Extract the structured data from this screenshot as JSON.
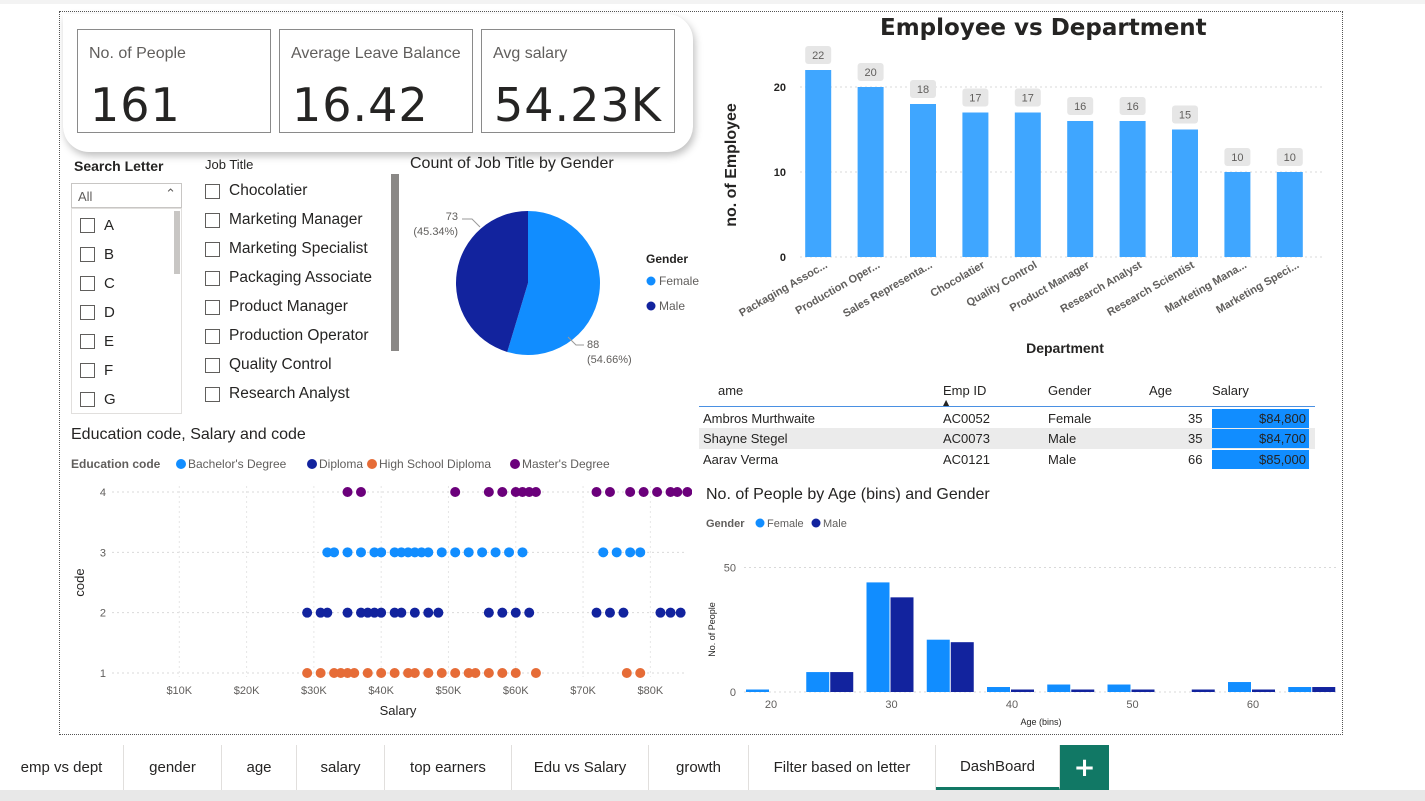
{
  "kpis": [
    {
      "label": "No. of People",
      "value": "161"
    },
    {
      "label": "Average Leave Balance",
      "value": "16.42"
    },
    {
      "label": "Avg salary",
      "value": "54.23K"
    }
  ],
  "search_letter": {
    "title": "Search Letter",
    "selected": "All",
    "options": [
      "A",
      "B",
      "C",
      "D",
      "E",
      "F",
      "G"
    ]
  },
  "job_title": {
    "title": "Job Title",
    "options": [
      "Chocolatier",
      "Marketing Manager",
      "Marketing Specialist",
      "Packaging Associate",
      "Product Manager",
      "Production Operator",
      "Quality Control",
      "Research Analyst"
    ]
  },
  "pie": {
    "title": "Count of Job Title by Gender",
    "legend_title": "Gender",
    "colors": {
      "Female": "#118dff",
      "Male": "#12239e"
    },
    "chart_data": {
      "type": "pie",
      "title": "Count of Job Title by Gender",
      "slices": [
        {
          "name": "Female",
          "value": 88,
          "label": "88",
          "pct": "(54.66%)"
        },
        {
          "name": "Male",
          "value": 73,
          "label": "73",
          "pct": "(45.34%)"
        }
      ]
    }
  },
  "bar": {
    "title": "Employee vs Department",
    "color": "#3fa6ff",
    "chart_data": {
      "type": "bar",
      "title": "Employee vs Department",
      "xlabel": "Department",
      "ylabel": "no. of Employee",
      "categories": [
        "Packaging Assoc...",
        "Production Oper...",
        "Sales Representa...",
        "Chocolatier",
        "Quality Control",
        "Product Manager",
        "Research Analyst",
        "Research Scientist",
        "Marketing Mana...",
        "Marketing Speci..."
      ],
      "values": [
        22,
        20,
        18,
        17,
        17,
        16,
        16,
        15,
        10,
        10
      ],
      "yticks": [
        0,
        10,
        20
      ],
      "ylim": [
        0,
        24
      ]
    }
  },
  "table": {
    "columns": [
      "ame",
      "Emp ID",
      "Gender",
      "Age",
      "Salary"
    ],
    "rows": [
      {
        "name": "Ambros Murthwaite",
        "id": "AC0052",
        "gender": "Female",
        "age": "35",
        "salary": "$84,800"
      },
      {
        "name": "Shayne Stegel",
        "id": "AC0073",
        "gender": "Male",
        "age": "35",
        "salary": "$84,700"
      },
      {
        "name": "Aarav Verma",
        "id": "AC0121",
        "gender": "Male",
        "age": "66",
        "salary": "$85,000"
      }
    ]
  },
  "scatter": {
    "title": "Education code, Salary and code",
    "legend_title": "Education code",
    "colors": {
      "Bachelor's Degree": "#118dff",
      "Diploma": "#12239e",
      "High School Diploma": "#e66c37",
      "Master's Degree": "#6b007b"
    },
    "chart_data": {
      "type": "scatter",
      "title": "Education code, Salary and code",
      "xlabel": "Salary",
      "ylabel": "code",
      "xticks": [
        "$10K",
        "$20K",
        "$30K",
        "$40K",
        "$50K",
        "$60K",
        "$70K",
        "$80K"
      ],
      "xlim": [
        0,
        85000
      ],
      "ylim": [
        1,
        4
      ],
      "series": [
        {
          "name": "Master's Degree",
          "y": 4,
          "x": [
            35000,
            37000,
            51000,
            56000,
            58000,
            60000,
            61000,
            62000,
            63000,
            72000,
            74000,
            77000,
            79000,
            81000,
            83000,
            84000,
            85500
          ]
        },
        {
          "name": "Bachelor's Degree",
          "y": 3,
          "x": [
            32000,
            33000,
            35000,
            37000,
            39000,
            40000,
            42000,
            43000,
            44000,
            45000,
            46000,
            47000,
            49000,
            51000,
            53000,
            55000,
            57000,
            59000,
            61000,
            73000,
            75000,
            77000,
            78500
          ]
        },
        {
          "name": "Diploma",
          "y": 2,
          "x": [
            29000,
            31000,
            32000,
            35000,
            37000,
            38000,
            39000,
            40000,
            42000,
            43000,
            45000,
            47000,
            48500,
            56000,
            58000,
            60000,
            62000,
            72000,
            74000,
            76000,
            81500,
            83000,
            84500
          ]
        },
        {
          "name": "High School Diploma",
          "y": 1,
          "x": [
            29000,
            31000,
            33000,
            34000,
            35000,
            36000,
            38000,
            40000,
            42000,
            44000,
            45000,
            47000,
            49000,
            51000,
            53000,
            54000,
            56000,
            58000,
            60000,
            63000,
            76500,
            78500
          ]
        }
      ]
    }
  },
  "hist": {
    "title": "No. of People by Age (bins) and Gender",
    "legend_title": "Gender",
    "colors": {
      "Female": "#118dff",
      "Male": "#12239e"
    },
    "chart_data": {
      "type": "bar",
      "title": "No. of People by Age (bins) and Gender",
      "xlabel": "Age (bins)",
      "ylabel": "No. of People",
      "bins": [
        20,
        25,
        30,
        35,
        40,
        45,
        50,
        55,
        60,
        65
      ],
      "series": [
        {
          "name": "Female",
          "values": [
            1,
            8,
            44,
            21,
            2,
            3,
            3,
            0,
            4,
            2
          ]
        },
        {
          "name": "Male",
          "values": [
            0,
            8,
            38,
            20,
            1,
            1,
            1,
            1,
            1,
            2
          ]
        }
      ],
      "xticks": [
        20,
        30,
        40,
        50,
        60
      ],
      "yticks": [
        0,
        50
      ],
      "ylim": [
        0,
        55
      ]
    }
  },
  "tabs": [
    "emp vs dept",
    "gender",
    "age",
    "salary",
    "top earners",
    "Edu vs Salary",
    "growth",
    "Filter based on letter",
    "DashBoard"
  ],
  "active_tab": "DashBoard",
  "add_tab": "+"
}
